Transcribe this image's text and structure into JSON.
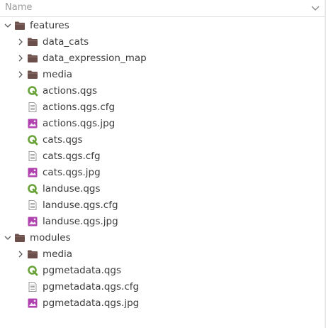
{
  "header": {
    "name_label": "Name",
    "sort_icon": "chevron-down-icon"
  },
  "tree": [
    {
      "label": "features",
      "type": "folder",
      "expanded": true,
      "level": 0
    },
    {
      "label": "data_cats",
      "type": "folder",
      "expanded": false,
      "level": 1
    },
    {
      "label": "data_expression_map",
      "type": "folder",
      "expanded": false,
      "level": 1
    },
    {
      "label": "media",
      "type": "folder",
      "expanded": false,
      "level": 1
    },
    {
      "label": "actions.qgs",
      "type": "qgs",
      "level": 1
    },
    {
      "label": "actions.qgs.cfg",
      "type": "cfg",
      "level": 1
    },
    {
      "label": "actions.qgs.jpg",
      "type": "jpg",
      "level": 1
    },
    {
      "label": "cats.qgs",
      "type": "qgs",
      "level": 1
    },
    {
      "label": "cats.qgs.cfg",
      "type": "cfg",
      "level": 1
    },
    {
      "label": "cats.qgs.jpg",
      "type": "jpg",
      "level": 1
    },
    {
      "label": "landuse.qgs",
      "type": "qgs",
      "level": 1
    },
    {
      "label": "landuse.qgs.cfg",
      "type": "cfg",
      "level": 1
    },
    {
      "label": "landuse.qgs.jpg",
      "type": "jpg",
      "level": 1
    },
    {
      "label": "modules",
      "type": "folder",
      "expanded": true,
      "level": 0
    },
    {
      "label": "media",
      "type": "folder",
      "expanded": false,
      "level": 1
    },
    {
      "label": "pgmetadata.qgs",
      "type": "qgs",
      "level": 1
    },
    {
      "label": "pgmetadata.qgs.cfg",
      "type": "cfg",
      "level": 1
    },
    {
      "label": "pgmetadata.qgs.jpg",
      "type": "jpg",
      "level": 1
    }
  ],
  "colors": {
    "folder": "#6b4f4a",
    "folder_tab": "#8a6e69",
    "qgs": "#6aa33a",
    "jpg": "#b043b0",
    "cfg": "#9a9a9a",
    "text": "#3c3c3c",
    "header_text": "#9a9a9a"
  }
}
